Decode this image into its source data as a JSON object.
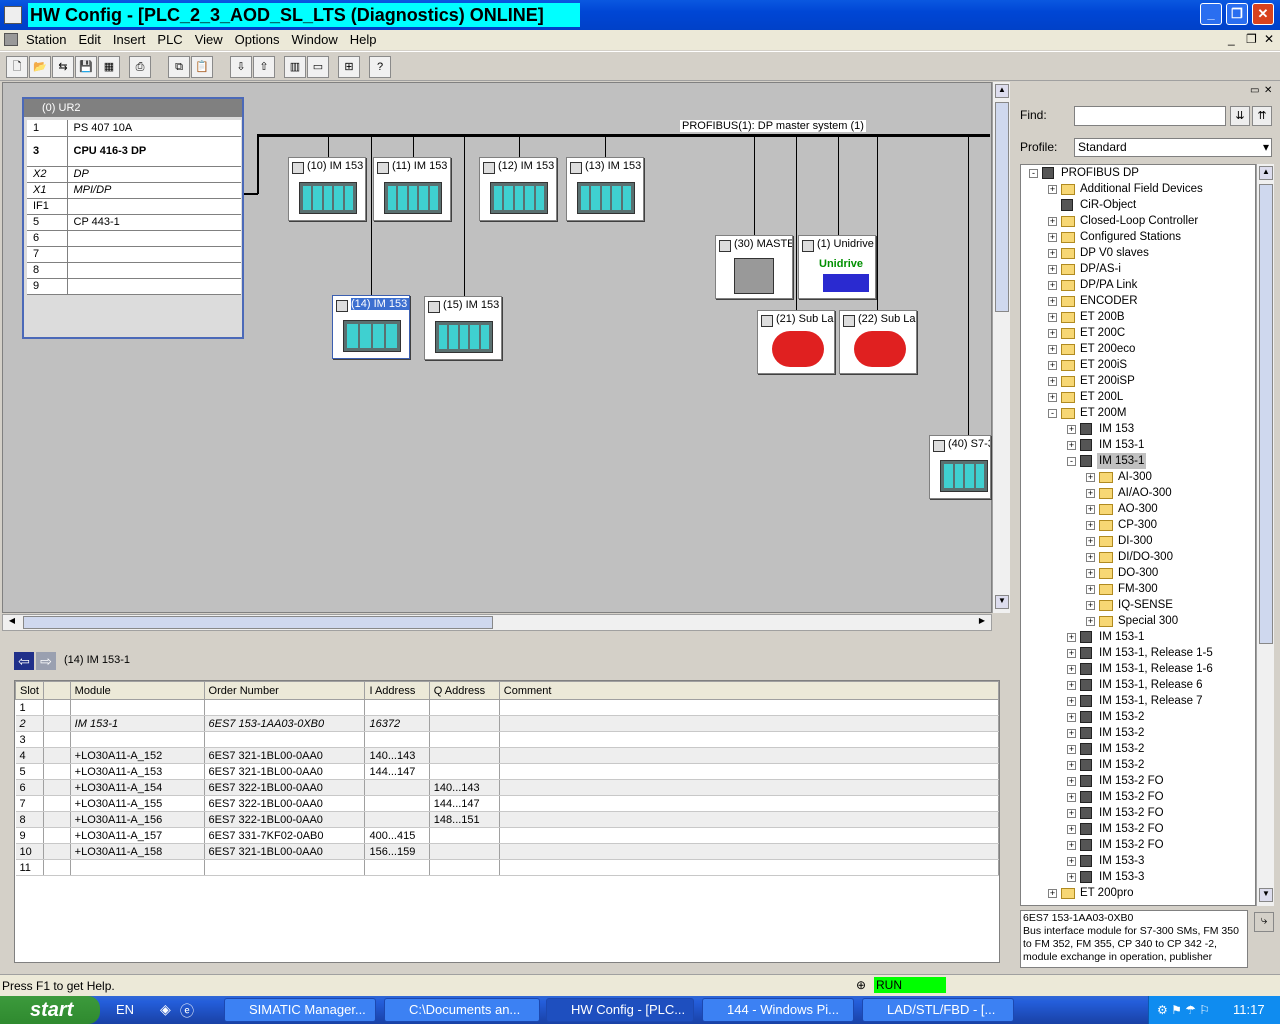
{
  "window": {
    "title": "HW Config - [PLC_2_3_AOD_SL_LTS (Diagnostics)  ONLINE]",
    "min": "_",
    "max": "❐",
    "close": "✕"
  },
  "menu": [
    "Station",
    "Edit",
    "Insert",
    "PLC",
    "View",
    "Options",
    "Window",
    "Help"
  ],
  "rack": {
    "title": "(0) UR2",
    "rows": [
      {
        "slot": "1",
        "module": "PS 407 10A"
      },
      {
        "slot": "3",
        "module": "CPU 416-3 DP"
      },
      {
        "slot": "X2",
        "module": "DP"
      },
      {
        "slot": "X1",
        "module": "MPI/DP"
      },
      {
        "slot": "IF1",
        "module": ""
      },
      {
        "slot": "5",
        "module": "CP 443-1"
      },
      {
        "slot": "6",
        "module": ""
      },
      {
        "slot": "7",
        "module": ""
      },
      {
        "slot": "8",
        "module": ""
      },
      {
        "slot": "9",
        "module": ""
      }
    ]
  },
  "dp_system": "PROFIBUS(1): DP master system (1)",
  "slaves": [
    "(10) IM 153",
    "(11) IM 153",
    "(12) IM 153",
    "(13) IM 153",
    "(14) IM 153",
    "(15) IM 153",
    "(30) MASTE",
    "(1) Unidrive",
    "(21) Sub La",
    "(22) Sub La",
    "(40) S7-3"
  ],
  "unidrive_text": "Unidrive",
  "detail": {
    "title": "(14)  IM 153-1",
    "columns": [
      "Slot",
      "",
      "Module",
      "Order Number",
      "I Address",
      "Q Address",
      "Comment"
    ],
    "rows": [
      [
        "1",
        "",
        "",
        "",
        "",
        "",
        ""
      ],
      [
        "2",
        "",
        "IM 153-1",
        "6ES7 153-1AA03-0XB0",
        "16372",
        "",
        ""
      ],
      [
        "3",
        "",
        "",
        "",
        "",
        "",
        ""
      ],
      [
        "4",
        "",
        "+LO30A11-A_152",
        "6ES7 321-1BL00-0AA0",
        "140...143",
        "",
        ""
      ],
      [
        "5",
        "",
        "+LO30A11-A_153",
        "6ES7 321-1BL00-0AA0",
        "144...147",
        "",
        ""
      ],
      [
        "6",
        "",
        "+LO30A11-A_154",
        "6ES7 322-1BL00-0AA0",
        "",
        "140...143",
        ""
      ],
      [
        "7",
        "",
        "+LO30A11-A_155",
        "6ES7 322-1BL00-0AA0",
        "",
        "144...147",
        ""
      ],
      [
        "8",
        "",
        "+LO30A11-A_156",
        "6ES7 322-1BL00-0AA0",
        "",
        "148...151",
        ""
      ],
      [
        "9",
        "",
        "+LO30A11-A_157",
        "6ES7 331-7KF02-0AB0",
        "400...415",
        "",
        ""
      ],
      [
        "10",
        "",
        "+LO30A11-A_158",
        "6ES7 321-1BL00-0AA0",
        "156...159",
        "",
        ""
      ],
      [
        "11",
        "",
        "",
        "",
        "",
        "",
        ""
      ]
    ]
  },
  "catalog": {
    "find_label": "Find:",
    "profile_label": "Profile:",
    "profile_value": "Standard",
    "tree": [
      {
        "t": "PROFIBUS DP",
        "l": 0,
        "e": "-",
        "k": "net"
      },
      {
        "t": "Additional Field Devices",
        "l": 1,
        "e": "+",
        "k": "f"
      },
      {
        "t": "CiR-Object",
        "l": 1,
        "e": "",
        "k": "m"
      },
      {
        "t": "Closed-Loop Controller",
        "l": 1,
        "e": "+",
        "k": "f"
      },
      {
        "t": "Configured Stations",
        "l": 1,
        "e": "+",
        "k": "f"
      },
      {
        "t": "DP V0 slaves",
        "l": 1,
        "e": "+",
        "k": "f"
      },
      {
        "t": "DP/AS-i",
        "l": 1,
        "e": "+",
        "k": "f"
      },
      {
        "t": "DP/PA Link",
        "l": 1,
        "e": "+",
        "k": "f"
      },
      {
        "t": "ENCODER",
        "l": 1,
        "e": "+",
        "k": "f"
      },
      {
        "t": "ET 200B",
        "l": 1,
        "e": "+",
        "k": "f"
      },
      {
        "t": "ET 200C",
        "l": 1,
        "e": "+",
        "k": "f"
      },
      {
        "t": "ET 200eco",
        "l": 1,
        "e": "+",
        "k": "f"
      },
      {
        "t": "ET 200iS",
        "l": 1,
        "e": "+",
        "k": "f"
      },
      {
        "t": "ET 200iSP",
        "l": 1,
        "e": "+",
        "k": "f"
      },
      {
        "t": "ET 200L",
        "l": 1,
        "e": "+",
        "k": "f"
      },
      {
        "t": "ET 200M",
        "l": 1,
        "e": "-",
        "k": "f"
      },
      {
        "t": "IM 153",
        "l": 2,
        "e": "+",
        "k": "m"
      },
      {
        "t": "IM 153-1",
        "l": 2,
        "e": "+",
        "k": "m"
      },
      {
        "t": "IM 153-1",
        "l": 2,
        "e": "-",
        "k": "m",
        "sel": true
      },
      {
        "t": "AI-300",
        "l": 3,
        "e": "+",
        "k": "f"
      },
      {
        "t": "AI/AO-300",
        "l": 3,
        "e": "+",
        "k": "f"
      },
      {
        "t": "AO-300",
        "l": 3,
        "e": "+",
        "k": "f"
      },
      {
        "t": "CP-300",
        "l": 3,
        "e": "+",
        "k": "f"
      },
      {
        "t": "DI-300",
        "l": 3,
        "e": "+",
        "k": "f"
      },
      {
        "t": "DI/DO-300",
        "l": 3,
        "e": "+",
        "k": "f"
      },
      {
        "t": "DO-300",
        "l": 3,
        "e": "+",
        "k": "f"
      },
      {
        "t": "FM-300",
        "l": 3,
        "e": "+",
        "k": "f"
      },
      {
        "t": "IQ-SENSE",
        "l": 3,
        "e": "+",
        "k": "f"
      },
      {
        "t": "Special 300",
        "l": 3,
        "e": "+",
        "k": "f"
      },
      {
        "t": "IM 153-1",
        "l": 2,
        "e": "+",
        "k": "m"
      },
      {
        "t": "IM 153-1, Release 1-5",
        "l": 2,
        "e": "+",
        "k": "m"
      },
      {
        "t": "IM 153-1, Release 1-6",
        "l": 2,
        "e": "+",
        "k": "m"
      },
      {
        "t": "IM 153-1, Release 6",
        "l": 2,
        "e": "+",
        "k": "m"
      },
      {
        "t": "IM 153-1, Release 7",
        "l": 2,
        "e": "+",
        "k": "m"
      },
      {
        "t": "IM 153-2",
        "l": 2,
        "e": "+",
        "k": "m"
      },
      {
        "t": "IM 153-2",
        "l": 2,
        "e": "+",
        "k": "m"
      },
      {
        "t": "IM 153-2",
        "l": 2,
        "e": "+",
        "k": "m"
      },
      {
        "t": "IM 153-2",
        "l": 2,
        "e": "+",
        "k": "m"
      },
      {
        "t": "IM 153-2 FO",
        "l": 2,
        "e": "+",
        "k": "m"
      },
      {
        "t": "IM 153-2 FO",
        "l": 2,
        "e": "+",
        "k": "m"
      },
      {
        "t": "IM 153-2 FO",
        "l": 2,
        "e": "+",
        "k": "m"
      },
      {
        "t": "IM 153-2 FO",
        "l": 2,
        "e": "+",
        "k": "m"
      },
      {
        "t": "IM 153-2 FO",
        "l": 2,
        "e": "+",
        "k": "m"
      },
      {
        "t": "IM 153-3",
        "l": 2,
        "e": "+",
        "k": "m"
      },
      {
        "t": "IM 153-3",
        "l": 2,
        "e": "+",
        "k": "m"
      },
      {
        "t": "ET 200pro",
        "l": 1,
        "e": "+",
        "k": "f"
      }
    ],
    "info_order": "6ES7 153-1AA03-0XB0",
    "info_text": "Bus interface module for S7-300 SMs, FM 350 to FM 352, FM 355, CP 340 to CP 342 -2, module exchange in operation, publisher"
  },
  "status": {
    "help": "Press F1 to get Help.",
    "mode": "RUN",
    "mode_color": "#00ff00"
  },
  "taskbar": {
    "start": "start",
    "lang": "EN",
    "time": "11:17",
    "tasks": [
      "SIMATIC Manager...",
      "C:\\Documents an...",
      "HW Config - [PLC...",
      "144 - Windows Pi...",
      "LAD/STL/FBD  - [..."
    ]
  }
}
